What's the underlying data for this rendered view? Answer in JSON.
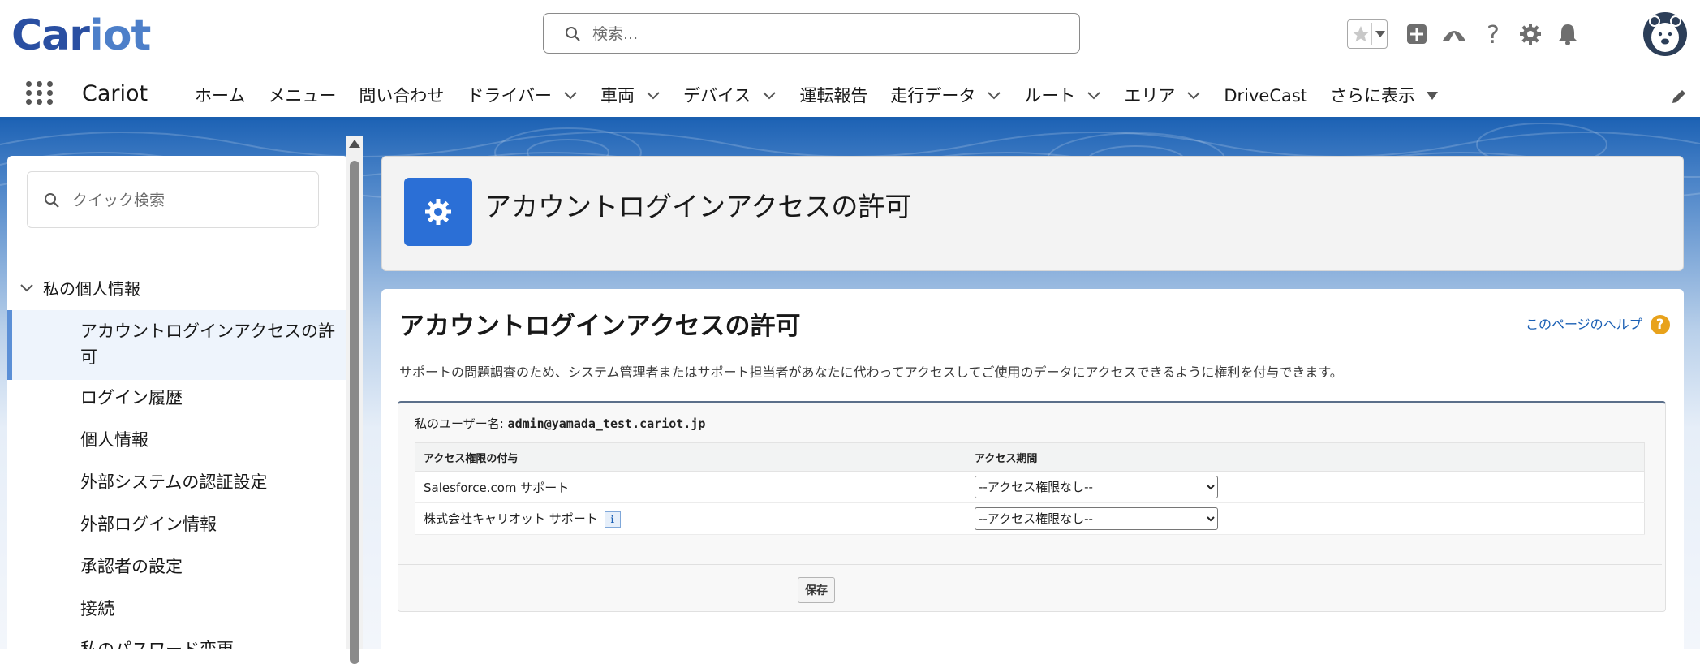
{
  "header": {
    "logo_prefix": "Car",
    "logo_suffix": "iot",
    "search_placeholder": "検索...",
    "icons": [
      "star-icon",
      "dropdown-icon",
      "add-icon",
      "trailhead-icon",
      "help-icon",
      "setup-gear-icon",
      "bell-icon",
      "avatar"
    ]
  },
  "nav": {
    "app_name": "Cariot",
    "items": [
      {
        "label": "ホーム",
        "dropdown": false
      },
      {
        "label": "メニュー",
        "dropdown": false
      },
      {
        "label": "問い合わせ",
        "dropdown": false
      },
      {
        "label": "ドライバー",
        "dropdown": true
      },
      {
        "label": "車両",
        "dropdown": true
      },
      {
        "label": "デバイス",
        "dropdown": true
      },
      {
        "label": "運転報告",
        "dropdown": false
      },
      {
        "label": "走行データ",
        "dropdown": true
      },
      {
        "label": "ルート",
        "dropdown": true
      },
      {
        "label": "エリア",
        "dropdown": true
      },
      {
        "label": "DriveCast",
        "dropdown": false
      },
      {
        "label": "さらに表示",
        "dropdown": true
      }
    ]
  },
  "sidebar": {
    "quick_search_placeholder": "クイック検索",
    "section_title": "私の個人情報",
    "items": [
      {
        "label": "アカウントログインアクセスの許可"
      },
      {
        "label": "ログイン履歴"
      },
      {
        "label": "個人情報"
      },
      {
        "label": "外部システムの認証設定"
      },
      {
        "label": "外部ログイン情報"
      },
      {
        "label": "承認者の設定"
      },
      {
        "label": "接続"
      },
      {
        "label": "私のパスワード変更"
      }
    ]
  },
  "page_header": {
    "title": "アカウントログインアクセスの許可"
  },
  "content": {
    "title": "アカウントログインアクセスの許可",
    "help_link": "このページのヘルプ",
    "description": "サポートの問題調査のため、システム管理者またはサポート担当者があなたに代わってアクセスしてご使用のデータにアクセスできるように権利を付与できます。",
    "username_label": "私のユーザー名:",
    "username_value": "admin@yamada_test.cariot.jp",
    "table": {
      "headers": [
        "アクセス権限の付与",
        "アクセス期間"
      ],
      "rows": [
        {
          "name": "Salesforce.com サポート",
          "info": false,
          "value": "--アクセス権限なし--"
        },
        {
          "name": "株式会社キャリオット サポート",
          "info": true,
          "value": "--アクセス権限なし--"
        }
      ]
    },
    "save_label": "保存"
  }
}
